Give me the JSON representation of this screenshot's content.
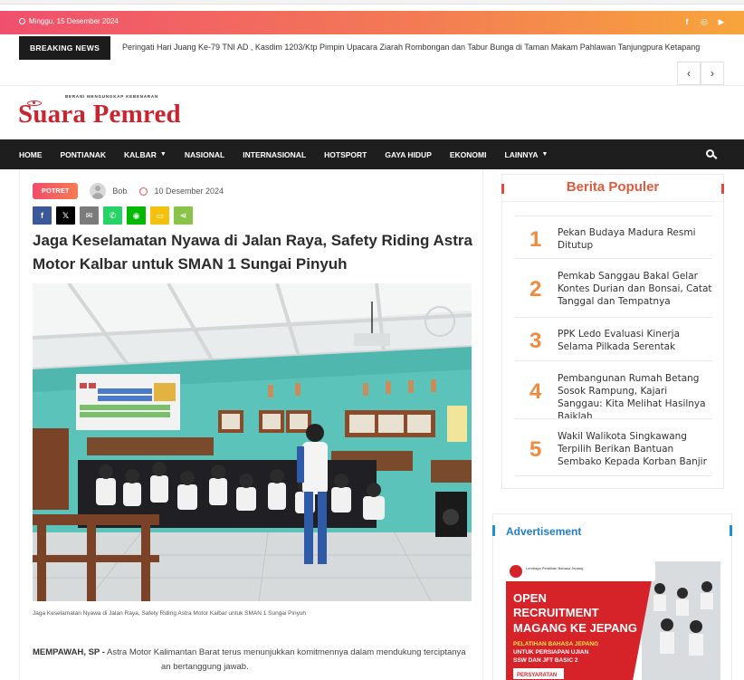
{
  "topbar": {
    "date": "Minggu, 15 Desember 2024",
    "social": [
      {
        "icon": "facebook-icon",
        "glyph": "f"
      },
      {
        "icon": "instagram-icon",
        "glyph": "◎"
      },
      {
        "icon": "youtube-icon",
        "glyph": "▶"
      }
    ]
  },
  "breaking": {
    "label": "BREAKING NEWS",
    "headline": "Peringati Hari Juang Ke-79 TNI AD , Kasdim 1203/Ktp Pimpin Upacara Ziarah Rombongan dan Tabur Bunga di Taman Makam Pahlawan Tanjungpura Ketapang",
    "prev": "‹",
    "next": "›"
  },
  "logo": {
    "tagline": "BERANI MENGUNGKAP KEBENARAN",
    "name": "Suara Pemred"
  },
  "nav": {
    "items": [
      {
        "label": "HOME",
        "dropdown": false
      },
      {
        "label": "PONTIANAK",
        "dropdown": false
      },
      {
        "label": "KALBAR",
        "dropdown": true
      },
      {
        "label": "NASIONAL",
        "dropdown": false
      },
      {
        "label": "INTERNASIONAL",
        "dropdown": false
      },
      {
        "label": "HOTSPORT",
        "dropdown": false
      },
      {
        "label": "GAYA HIDUP",
        "dropdown": false
      },
      {
        "label": "EKONOMI",
        "dropdown": false
      },
      {
        "label": "LAINNYA",
        "dropdown": true
      }
    ]
  },
  "article": {
    "category": "POTRET",
    "author": "Bob",
    "date": "10 Desember 2024",
    "share": [
      {
        "icon": "facebook-share-icon",
        "glyph": "f",
        "color": "#3b5998"
      },
      {
        "icon": "x-share-icon",
        "glyph": "𝕏",
        "color": "#000000"
      },
      {
        "icon": "email-share-icon",
        "glyph": "✉",
        "color": "#7b7b7b"
      },
      {
        "icon": "whatsapp-share-icon",
        "glyph": "✆",
        "color": "#25d366"
      },
      {
        "icon": "line-share-icon",
        "glyph": "◉",
        "color": "#00b900"
      },
      {
        "icon": "sms-share-icon",
        "glyph": "▭",
        "color": "#f4c20d"
      },
      {
        "icon": "more-share-icon",
        "glyph": "⋖",
        "color": "#8bc34a"
      }
    ],
    "title": "Jaga Keselamatan Nyawa di Jalan Raya, Safety Riding Astra Motor Kalbar untuk SMAN 1 Sungai Pinyuh",
    "caption": "Jaga Keselamatan Nyawa di Jalan Raya, Safety Riding Astra Motor Kalbar untuk SMAN 1 Sungai Pinyuh",
    "lead": "MEMPAWAH, SP -",
    "body": " Astra Motor Kalimantan Barat terus menunjukkan komitmennya dalam mendukung terciptanya",
    "body2": "an bertanggung jawab."
  },
  "popular": {
    "heading": "Berita Populer",
    "items": [
      {
        "num": "1",
        "title": "Pekan Budaya Madura Resmi Ditutup"
      },
      {
        "num": "2",
        "title": "Pemkab Sanggau Bakal Gelar Kontes Durian dan Bonsai, Catat Tanggal dan Tempatnya"
      },
      {
        "num": "3",
        "title": "PPK Ledo Evaluasi Kinerja Selama Pilkada Serentak"
      },
      {
        "num": "4",
        "title": "Pembangunan Rumah Betang Sosok Rampung, Kajari Sanggau: Kita Melihat Hasilnya Baiklah"
      },
      {
        "num": "5",
        "title": "Wakil Walikota Singkawang Terpilih Berikan Bantuan Sembako Kepada Korban Banjir"
      }
    ]
  },
  "advert": {
    "heading": "Advertisement",
    "org": "Lembaga Pelatihan Bahasa Jepang",
    "line1": "OPEN",
    "line2": "RECRUITMENT",
    "line3": "MAGANG KE JEPANG",
    "line4": "PELATIHAN BAHASA JEPANG",
    "line5": "UNTUK PERSIAPAN UJIAN",
    "line6": "SSW DAN JFT BASIC 2",
    "line7": "PERSYARATAN"
  }
}
